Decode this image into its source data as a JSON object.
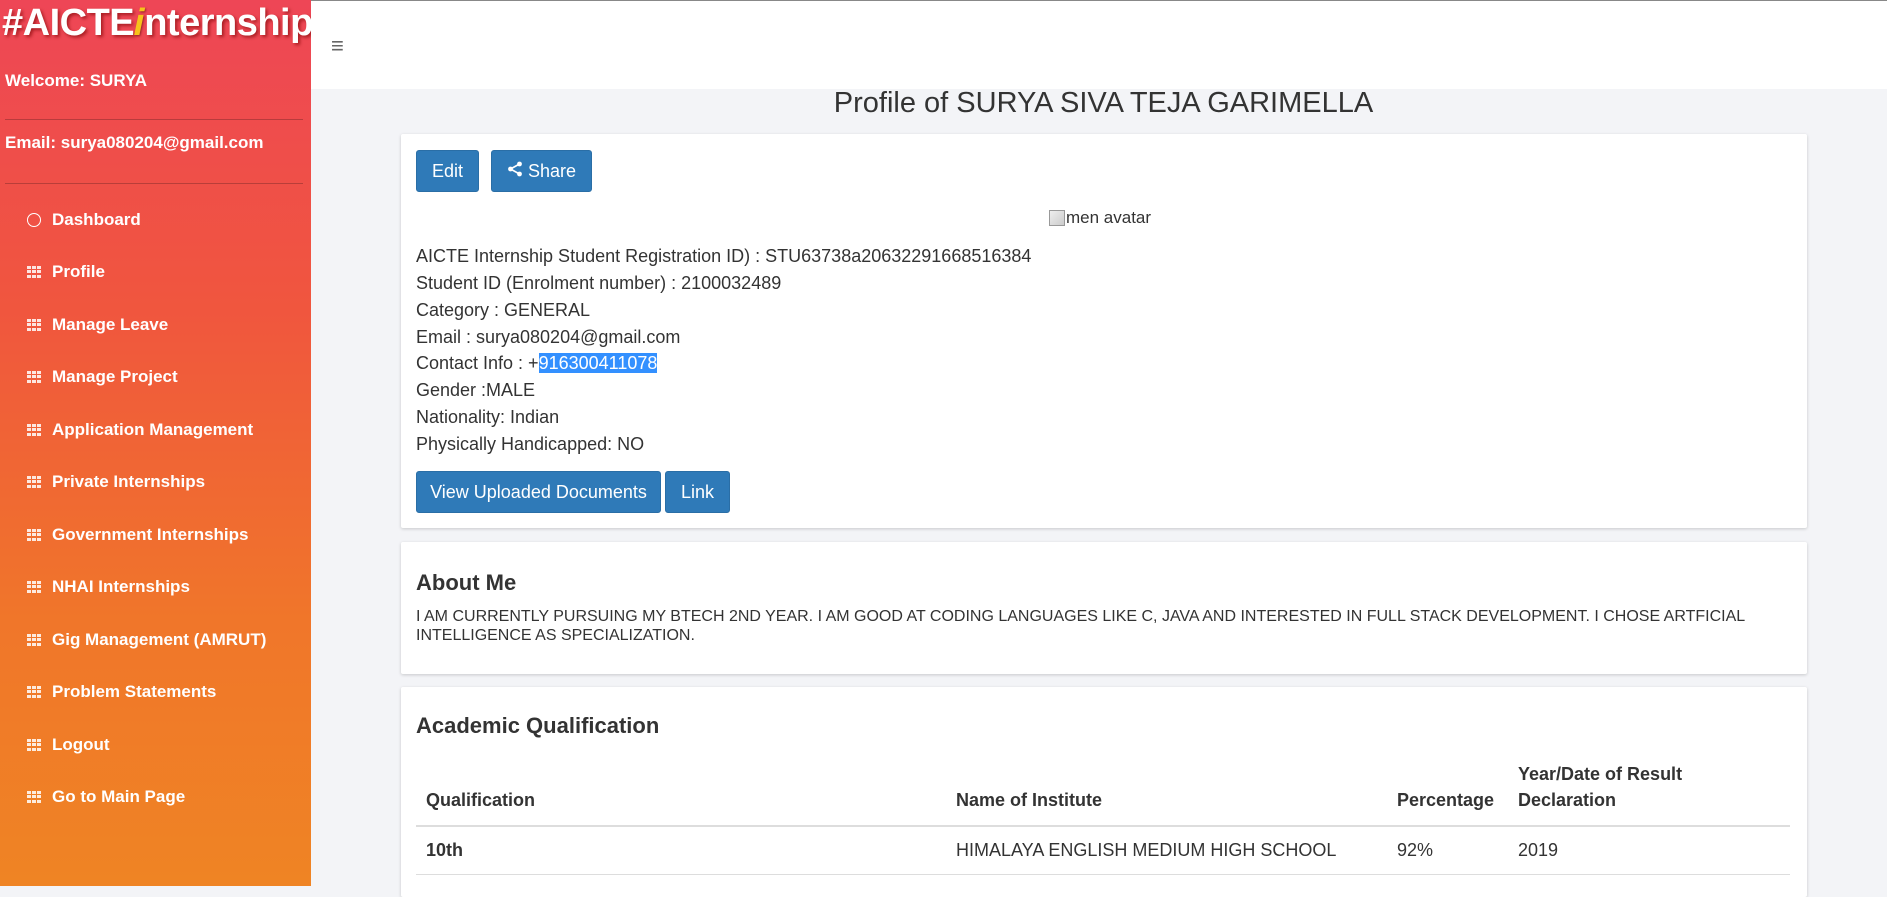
{
  "sidebar": {
    "logo": {
      "pre": "#AICTE",
      "i": "i",
      "post": "nternship"
    },
    "welcome": "Welcome: SURYA",
    "email": "Email: surya080204@gmail.com",
    "items": [
      {
        "label": "Dashboard",
        "icon": "circle-icon"
      },
      {
        "label": "Profile",
        "icon": "grid-icon"
      },
      {
        "label": "Manage Leave",
        "icon": "grid-icon"
      },
      {
        "label": "Manage Project",
        "icon": "grid-icon"
      },
      {
        "label": "Application Management",
        "icon": "grid-icon"
      },
      {
        "label": "Private Internships",
        "icon": "grid-icon"
      },
      {
        "label": "Government Internships",
        "icon": "grid-icon"
      },
      {
        "label": "NHAI Internships",
        "icon": "grid-icon"
      },
      {
        "label": "Gig Management (AMRUT)",
        "icon": "grid-icon"
      },
      {
        "label": "Problem Statements",
        "icon": "grid-icon"
      },
      {
        "label": "Logout",
        "icon": "grid-icon"
      },
      {
        "label": "Go to Main Page",
        "icon": "grid-icon"
      }
    ]
  },
  "topbar": {
    "menu_glyph": "≡"
  },
  "page_title": "Profile of SURYA SIVA TEJA GARIMELLA",
  "profile": {
    "edit_label": "Edit",
    "share_label": "Share",
    "avatar_alt": "men avatar",
    "registration": "AICTE Internship Student Registration ID) : STU63738a20632291668516384",
    "student_id": "Student ID (Enrolment number) : 2100032489",
    "category": "Category : GENERAL",
    "email": "Email : surya080204@gmail.com",
    "contact_prefix": "Contact Info : +",
    "contact_number": "916300411078",
    "gender": "Gender :MALE",
    "nationality": "Nationality: Indian",
    "handicapped": "Physically Handicapped: NO",
    "view_docs_label": "View Uploaded Documents",
    "link_label": "Link"
  },
  "about": {
    "title": "About Me",
    "text": "I AM CURRENTLY PURSUING MY BTECH 2ND YEAR. I AM GOOD AT CODING LANGUAGES LIKE C, JAVA AND INTERESTED IN FULL STACK DEVELOPMENT. I CHOSE ARTFICIAL INTELLIGENCE AS SPECIALIZATION."
  },
  "academic": {
    "title": "Academic Qualification",
    "headers": [
      "Qualification",
      "Name of Institute",
      "Percentage",
      "Year/Date of Result Declaration"
    ],
    "rows": [
      [
        "10th",
        "HIMALAYA ENGLISH MEDIUM HIGH SCHOOL",
        "92%",
        "2019"
      ]
    ]
  }
}
